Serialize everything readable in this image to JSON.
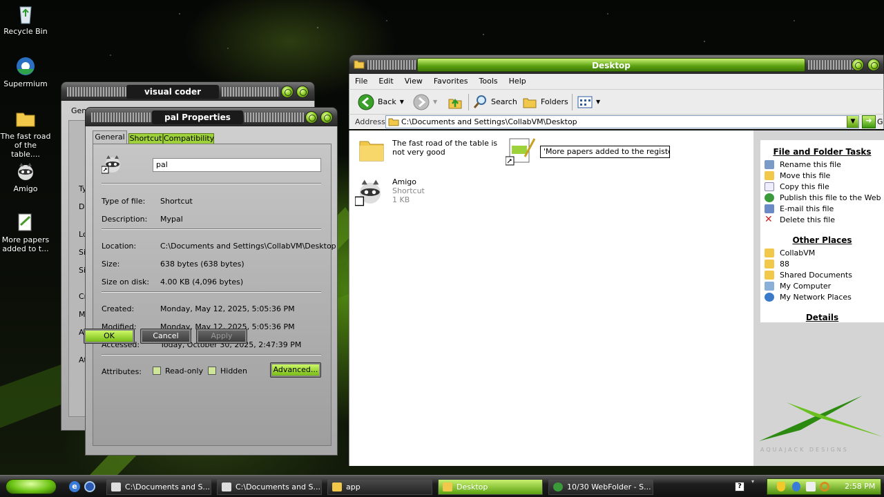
{
  "desktop": {
    "icons": [
      {
        "label": "Recycle Bin",
        "icon": "recycle-bin-icon"
      },
      {
        "label": "Supermium",
        "icon": "browser-icon"
      },
      {
        "label": "The fast road of the table....",
        "icon": "folder-icon"
      },
      {
        "label": "Amigo",
        "icon": "raccoon-icon"
      },
      {
        "label": "More papers added to t...",
        "icon": "document-icon"
      }
    ]
  },
  "back_dialog": {
    "title": "visual coder Properties",
    "tab_partial": "Gener",
    "side_labels": [
      "Ty",
      "De",
      "Lo",
      "Si",
      "Si",
      "Cr",
      "Mo",
      "Ac",
      "At"
    ]
  },
  "pal_dialog": {
    "title": "pal Properties",
    "tabs": [
      "General",
      "Shortcut",
      "Compatibility"
    ],
    "name_value": "pal",
    "rows": {
      "type_label": "Type of file:",
      "type_value": "Shortcut",
      "desc_label": "Description:",
      "desc_value": "Mypal",
      "location_label": "Location:",
      "location_value": "C:\\Documents and Settings\\CollabVM\\Desktop",
      "size_label": "Size:",
      "size_value": "638 bytes (638 bytes)",
      "sizeondisk_label": "Size on disk:",
      "sizeondisk_value": "4.00 KB (4,096 bytes)",
      "created_label": "Created:",
      "created_value": "Monday, May 12, 2025, 5:05:36 PM",
      "modified_label": "Modified:",
      "modified_value": "Monday, May 12, 2025, 5:05:36 PM",
      "accessed_label": "Accessed:",
      "accessed_value": "Today, October 30, 2025, 2:47:39 PM",
      "attributes_label": "Attributes:"
    },
    "readonly_label": "Read-only",
    "hidden_label": "Hidden",
    "advanced_label": "Advanced...",
    "ok_label": "OK",
    "cancel_label": "Cancel",
    "apply_label": "Apply"
  },
  "explorer": {
    "title": "Desktop",
    "menu": [
      "File",
      "Edit",
      "View",
      "Favorites",
      "Tools",
      "Help"
    ],
    "toolbar": {
      "back": "Back",
      "search": "Search",
      "folders": "Folders"
    },
    "address_label": "Address",
    "address_value": "C:\\Documents and Settings\\CollabVM\\Desktop",
    "go_label": "G",
    "files": {
      "folder_name": "The fast road of the table is not very good",
      "rename_value": "'More papers added to the register",
      "amigo_name": "Amigo",
      "amigo_type": "Shortcut",
      "amigo_size": "1 KB"
    },
    "tasks_title": "File and Folder Tasks",
    "tasks": [
      "Rename this file",
      "Move this file",
      "Copy this file",
      "Publish this file to the Web",
      "E-mail this file",
      "Delete this file"
    ],
    "places_title": "Other Places",
    "places": [
      "CollabVM",
      "88",
      "Shared Documents",
      "My Computer",
      "My Network Places"
    ],
    "details_title": "Details",
    "watermark": "AQUAJACK DESIGNS"
  },
  "taskbar": {
    "items": [
      "C:\\Documents and S...",
      "C:\\Documents and S...",
      "app",
      "Desktop",
      "10/30 WebFolder - S..."
    ],
    "clock": "2:58 PM"
  },
  "colors": {
    "accent_green": "#8fcf22",
    "titlebar_dark": "#2a2a2a"
  }
}
